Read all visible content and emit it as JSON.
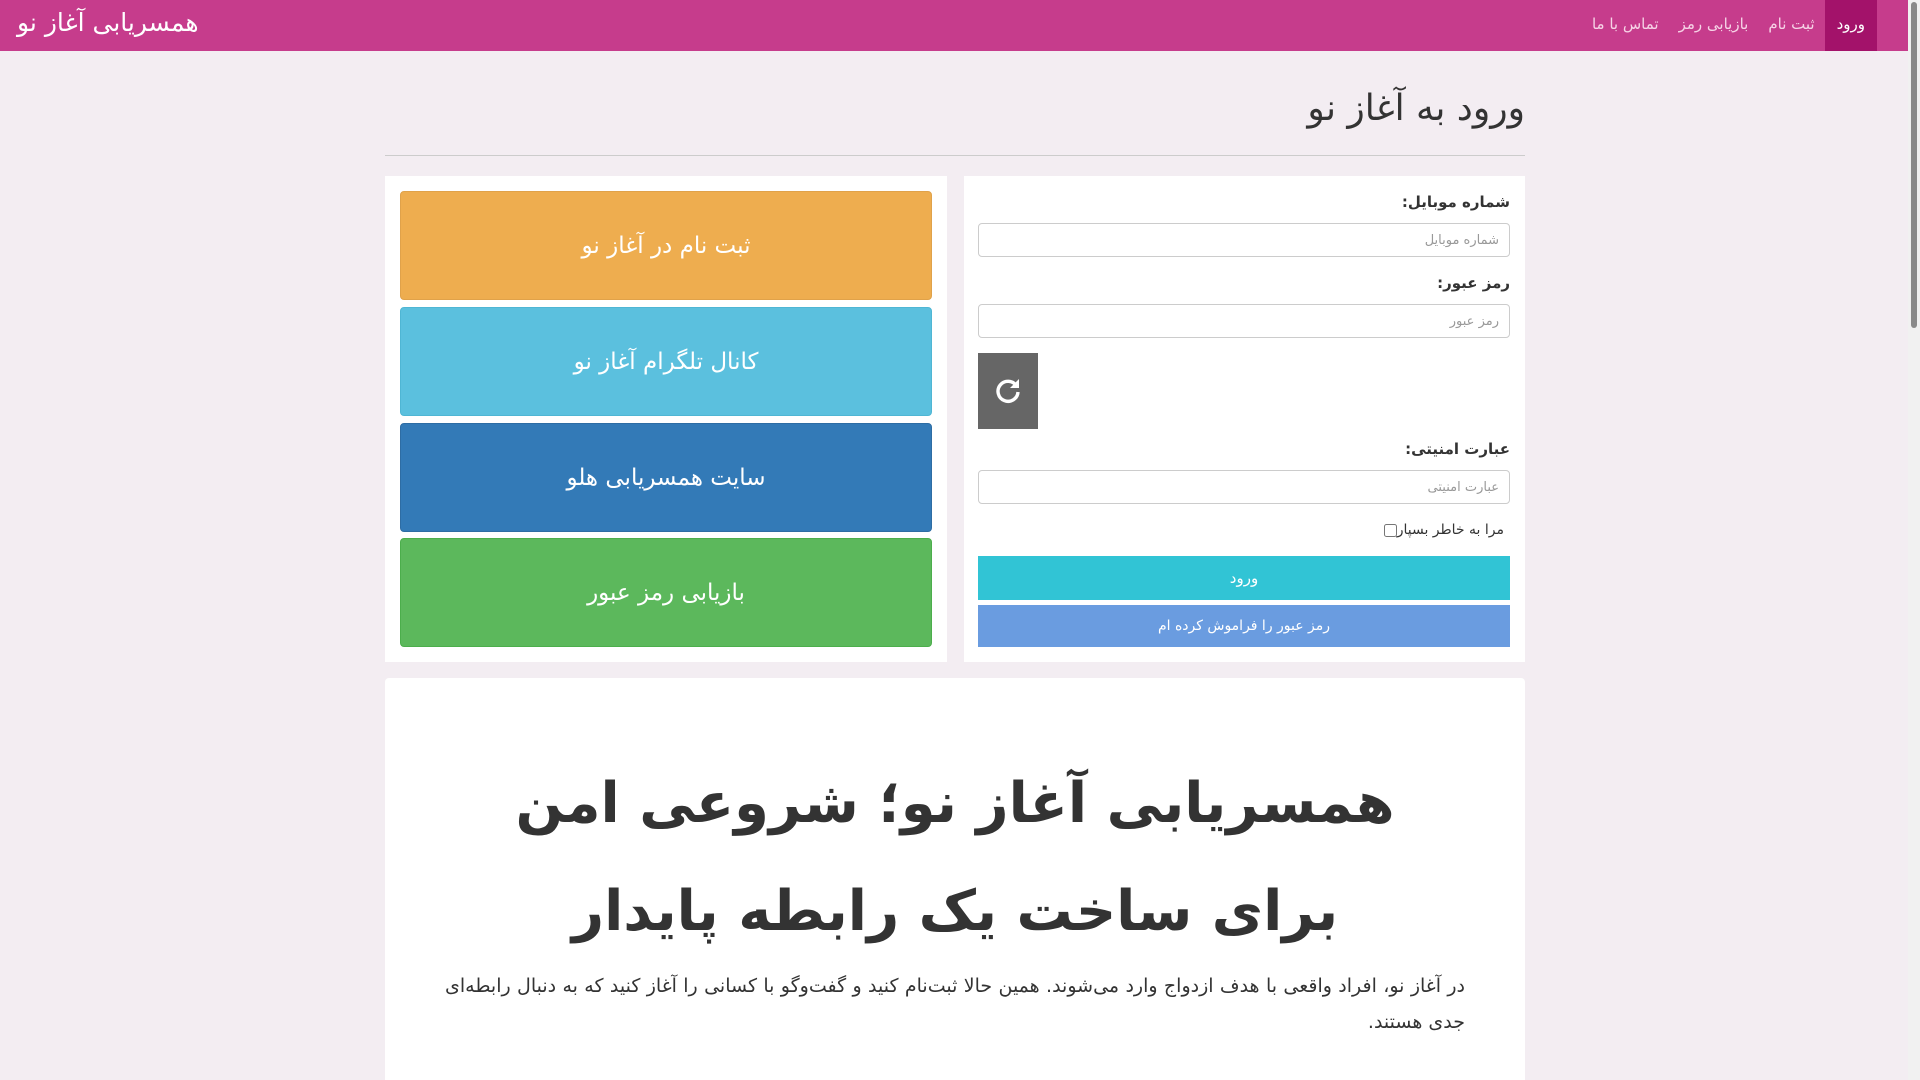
{
  "navbar": {
    "brand": "همسریابی آغاز نو",
    "items": [
      "ورود",
      "ثبت نام",
      "بازیابی رمز",
      "تماس با ما"
    ],
    "active_index": 0,
    "color": "#c63c8c",
    "active_color": "#a3126a"
  },
  "page": {
    "title": "ورود به آغاز نو"
  },
  "login_form": {
    "mobile_label": "شماره موبایل:",
    "mobile_placeholder": "شماره موبایل",
    "password_label": "رمز عبور:",
    "password_placeholder": "رمز عبور",
    "captcha_refresh_icon": "refresh-icon",
    "security_label": "عبارت امنیتی:",
    "security_placeholder": "عبارت امنیتی",
    "remember_label": "مرا به خاطر بسپار",
    "remember_checked": false,
    "login_button": "ورود",
    "forgot_button": "رمز عبور را فراموش کرده ام",
    "login_color": "#31c4d5",
    "forgot_color": "#6a9ce0"
  },
  "tiles": [
    {
      "label": "ثبت نام در آغاز نو",
      "color": "#eead4f"
    },
    {
      "label": "کانال تلگرام آغاز نو",
      "color": "#5bc0de"
    },
    {
      "label": "سایت همسریابی هلو",
      "color": "#337ab7"
    },
    {
      "label": "بازیابی رمز عبور",
      "color": "#5cb85c"
    }
  ],
  "content": {
    "headline": "همسریابی آغاز نو؛ شروعی امن برای ساخت یک رابطه پایدار",
    "paragraph": "در آغاز نو، افراد واقعی با هدف ازدواج وارد می‌شوند. همین حالا ثبت‌نام کنید و گفت‌وگو با کسانی را آغاز کنید که به دنبال رابطه‌ای جدی هستند."
  }
}
